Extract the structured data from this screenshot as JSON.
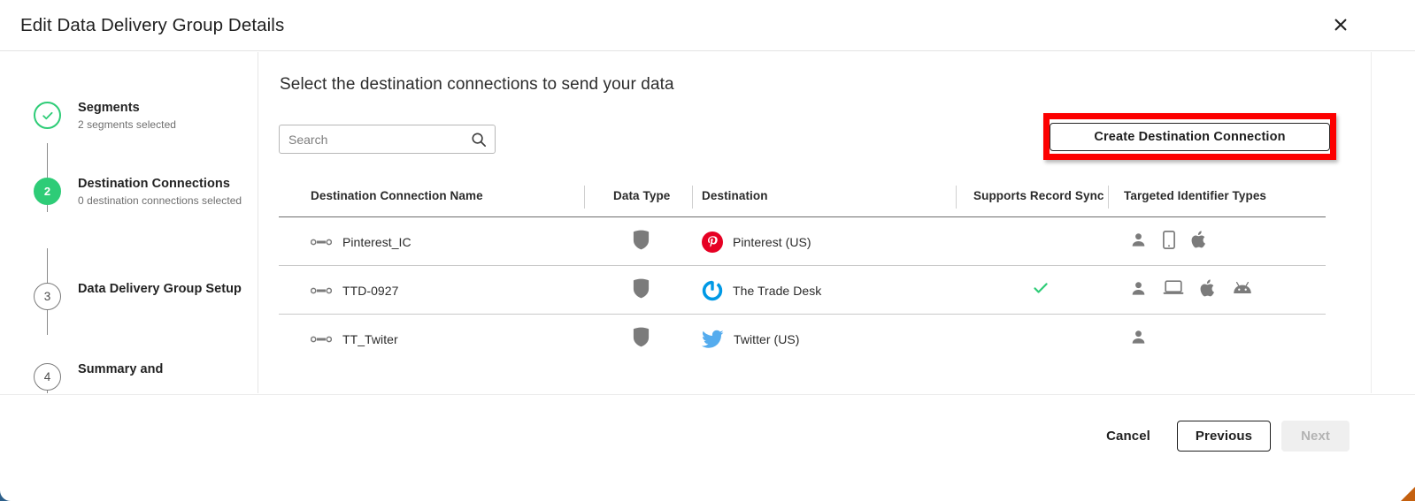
{
  "header": {
    "title": "Edit Data Delivery Group Details",
    "close_icon": "close-icon"
  },
  "stepper": {
    "steps": [
      {
        "marker": "✓",
        "state": "done",
        "label": "Segments",
        "sub": "2 segments selected"
      },
      {
        "marker": "2",
        "state": "active",
        "label": "Destination Connections",
        "sub": "0 destination connections selected"
      },
      {
        "marker": "3",
        "state": "todo",
        "label": "Data Delivery Group Setup",
        "sub": ""
      },
      {
        "marker": "4",
        "state": "todo",
        "label": "Summary and",
        "sub": ""
      }
    ]
  },
  "main": {
    "heading": "Select the destination connections to send your data",
    "search": {
      "value": "",
      "placeholder": "Search",
      "icon": "search-icon"
    },
    "create_button": {
      "label": "Create Destination Connection",
      "highlighted": true
    }
  },
  "table": {
    "columns": [
      "Destination Connection Name",
      "Data Type",
      "Destination",
      "Supports Record Sync",
      "Targeted Identifier Types"
    ],
    "rows": [
      {
        "connection_name": "Pinterest_IC",
        "data_type_icon": "shield-icon",
        "destination": "Pinterest (US)",
        "destination_logo": "pinterest-logo",
        "supports_record_sync": false,
        "identifier_types": [
          "person-icon",
          "mobile-phone-icon",
          "apple-icon"
        ]
      },
      {
        "connection_name": "TTD-0927",
        "data_type_icon": "shield-icon",
        "destination": "The Trade Desk",
        "destination_logo": "trade-desk-logo",
        "supports_record_sync": true,
        "identifier_types": [
          "person-icon",
          "laptop-icon",
          "apple-icon",
          "android-icon"
        ]
      },
      {
        "connection_name": "TT_Twiter",
        "data_type_icon": "shield-icon",
        "destination": "Twitter (US)",
        "destination_logo": "twitter-logo",
        "supports_record_sync": false,
        "identifier_types": [
          "person-icon"
        ]
      }
    ]
  },
  "footer": {
    "cancel_label": "Cancel",
    "previous_label": "Previous",
    "next_label": "Next",
    "next_disabled": true
  },
  "colors": {
    "accent_green": "#2ecc77",
    "highlight_red": "#fc0000",
    "pinterest_red": "#e60023",
    "trade_desk_blue": "#0099e5",
    "twitter_blue": "#55acee",
    "icon_gray": "#7b7b7b"
  }
}
